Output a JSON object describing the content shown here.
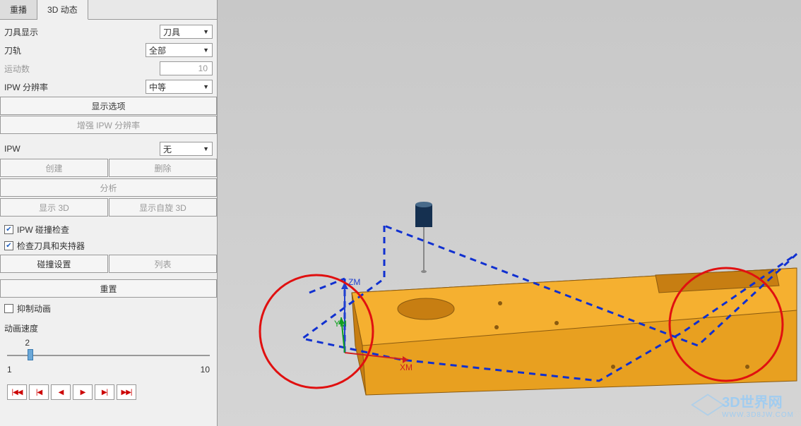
{
  "tabs": {
    "replay": "重播",
    "dynamic3d": "3D 动态"
  },
  "labels": {
    "toolDisplay": "刀具显示",
    "trajectory": "刀轨",
    "motionCount": "运动数",
    "ipwRes": "IPW 分辨率",
    "ipw": "IPW",
    "animSpeed": "动画速度"
  },
  "selects": {
    "toolDisplay": "刀具",
    "trajectory": "全部",
    "ipwRes": "中等",
    "ipw": "无"
  },
  "values": {
    "motionCount": "10"
  },
  "buttons": {
    "displayOpts": "显示选项",
    "enhanceIpw": "增强 IPW 分辨率",
    "create": "创建",
    "del": "删除",
    "analyze": "分析",
    "show3d": "显示 3D",
    "showSpin3d": "显示自旋 3D",
    "collSettings": "碰撞设置",
    "list": "列表",
    "reset": "重置"
  },
  "checkboxes": {
    "ipwCollision": "IPW 碰撞检查",
    "toolCollision": "检查刀具和夹持器",
    "suppressAnim": "抑制动画"
  },
  "slider": {
    "value": "2",
    "min": "1",
    "max": "10"
  },
  "axes": {
    "x": "XM",
    "y": "YM",
    "z": "ZM"
  },
  "watermark": {
    "title": "3D世界网",
    "sub": "WWW.3D8JW.COM"
  },
  "playback": {
    "first": "|◀◀",
    "prev": "|◀",
    "stepback": "◀",
    "play": "▶",
    "stepfwd": "▶|",
    "last": "▶▶|"
  }
}
